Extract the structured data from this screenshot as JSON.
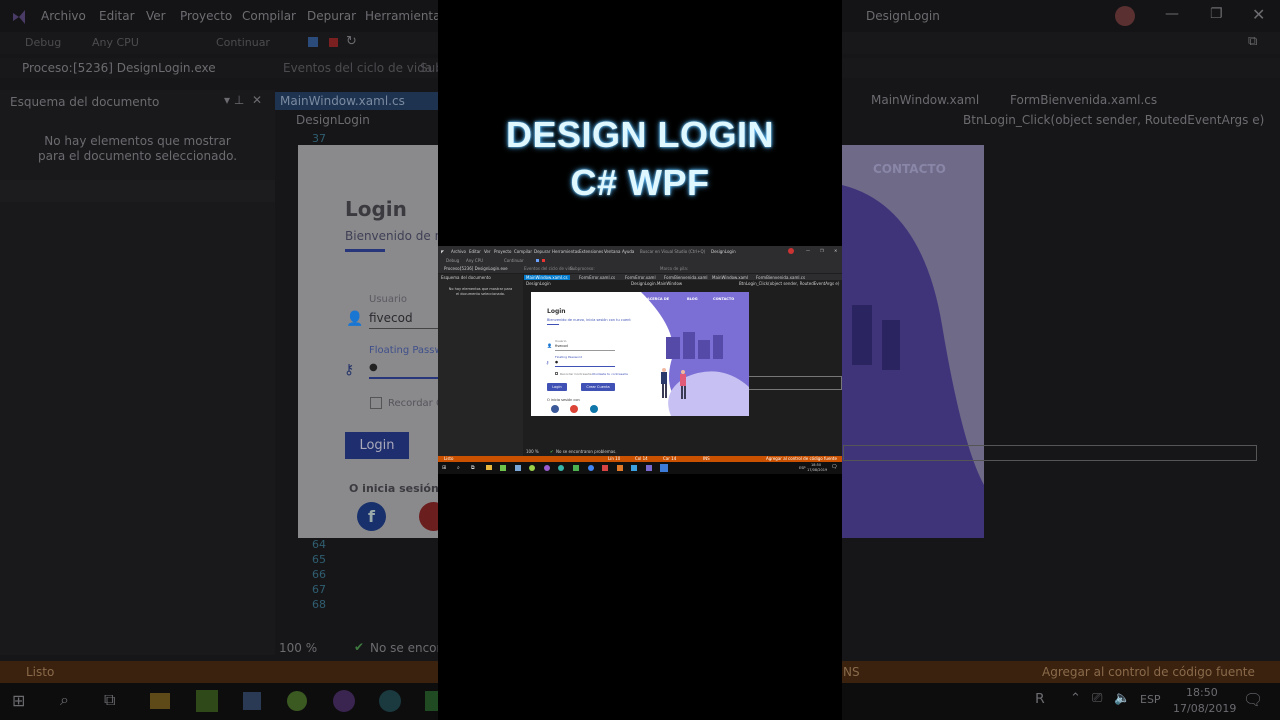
{
  "background_ide": {
    "menu": [
      "Archivo",
      "Editar",
      "Ver",
      "Proyecto",
      "Compilar",
      "Depurar",
      "Herramientas"
    ],
    "window_title": "DesignLogin",
    "toolbar": {
      "config": "Debug",
      "platform": "Any CPU",
      "continue": "Continuar"
    },
    "process_label": "Proceso:",
    "process_value": "[5236] DesignLogin.exe",
    "lifecycle": "Eventos del ciclo de vida",
    "lifecycle_more": "Sub",
    "left_panel_title": "Esquema del documento",
    "left_panel_empty": "No hay elementos que mostrar para el documento seleccionado.",
    "tab_active": "MainWindow.xaml.cs",
    "breadcrumb": "DesignLogin",
    "right_tab1": "MainWindow.xaml",
    "right_tab2": "FormBienvenida.xaml.cs",
    "method_breadcrumb": "BtnLogin_Click(object sender, RoutedEventArgs e)",
    "line_numbers": [
      "37",
      "64",
      "65",
      "66",
      "67",
      "68"
    ],
    "zoom": "100 %",
    "issues": "No se encontr",
    "status_ready": "Listo",
    "status_right": "Agregar al control de código fuente",
    "status_right_fragment": "NS",
    "clock_time": "18:50",
    "clock_date": "17/08/2019",
    "lang": "ESP",
    "login_form": {
      "title": "Login",
      "subtitle": "Bienvenido de nue",
      "user_label": "Usuario",
      "user_value": "fivecod",
      "password_label": "Floating Password",
      "password_value": "●",
      "remember": "Recordar Co",
      "login_button": "Login",
      "social_text": "O inicia sesión co"
    },
    "art_contact": "CONTACTO"
  },
  "headline": {
    "line1": "DESIGN LOGIN",
    "line2": "C# WPF"
  },
  "mini": {
    "menu": [
      "Archivo",
      "Editar",
      "Ver",
      "Proyecto",
      "Compilar",
      "Depurar",
      "Herramientas",
      "Extensiones",
      "Ventana",
      "Ayuda"
    ],
    "search": "Buscar en Visual Studio (Ctrl+Q)",
    "title": "DesignLogin",
    "config": "Debug",
    "platform": "Any CPU",
    "continue": "Continuar",
    "process": "Proceso:",
    "process_value": "[5236] DesignLogin.exe",
    "lifecycle": "Eventos del ciclo de vida",
    "thread": "Subproceso:",
    "frame": "Marco de pila:",
    "tabs": [
      "MainWindow.xaml.cs",
      "FormError.xaml.cs",
      "FormError.xaml",
      "FormBienvenida.xaml",
      "MainWindow.xaml",
      "FormBienvenida.xaml.cs"
    ],
    "left_title": "Esquema del documento",
    "left_empty": "No hay elementos que mostrar para el documento seleccionado.",
    "breadcrumb": "DesignLogin",
    "breadcrumb2": "DesignLogin.MainWindow",
    "breadcrumb3": "BtnLogin_Click(object sender, RoutedEventArgs e)",
    "login": {
      "title": "Login",
      "subtitle": "Bienvenido de nuevo, inicia sesión con tu cuenta",
      "user_label": "Usuario",
      "user_value": "fivecod",
      "pass_label": "Floating Password",
      "pass_value": "●",
      "remember": "Recordar Contraseña",
      "forgot": "Olvidaste tu contraseña",
      "login_btn": "Login",
      "create_btn": "Crear Cuenta",
      "social": "O inicia sesión con",
      "nav": [
        "ACERCA DE",
        "BLOG",
        "CONTACTO"
      ]
    },
    "zoom": "100 %",
    "issues": "No se encontraron problemas.",
    "status_ready": "Listo",
    "status_ln": "Lín 10",
    "status_col": "Col 14",
    "status_car": "Car 14",
    "status_ins": "INS",
    "status_right": "Agregar al control de código fuente",
    "lang": "ESP",
    "time": "18:50",
    "date": "17/08/2019"
  },
  "colors": {
    "accent_blue": "#3f51b5",
    "status_orange": "#ca5100",
    "headline_glow": "#4fb8ff",
    "art_purple": "#7b6fd6"
  }
}
